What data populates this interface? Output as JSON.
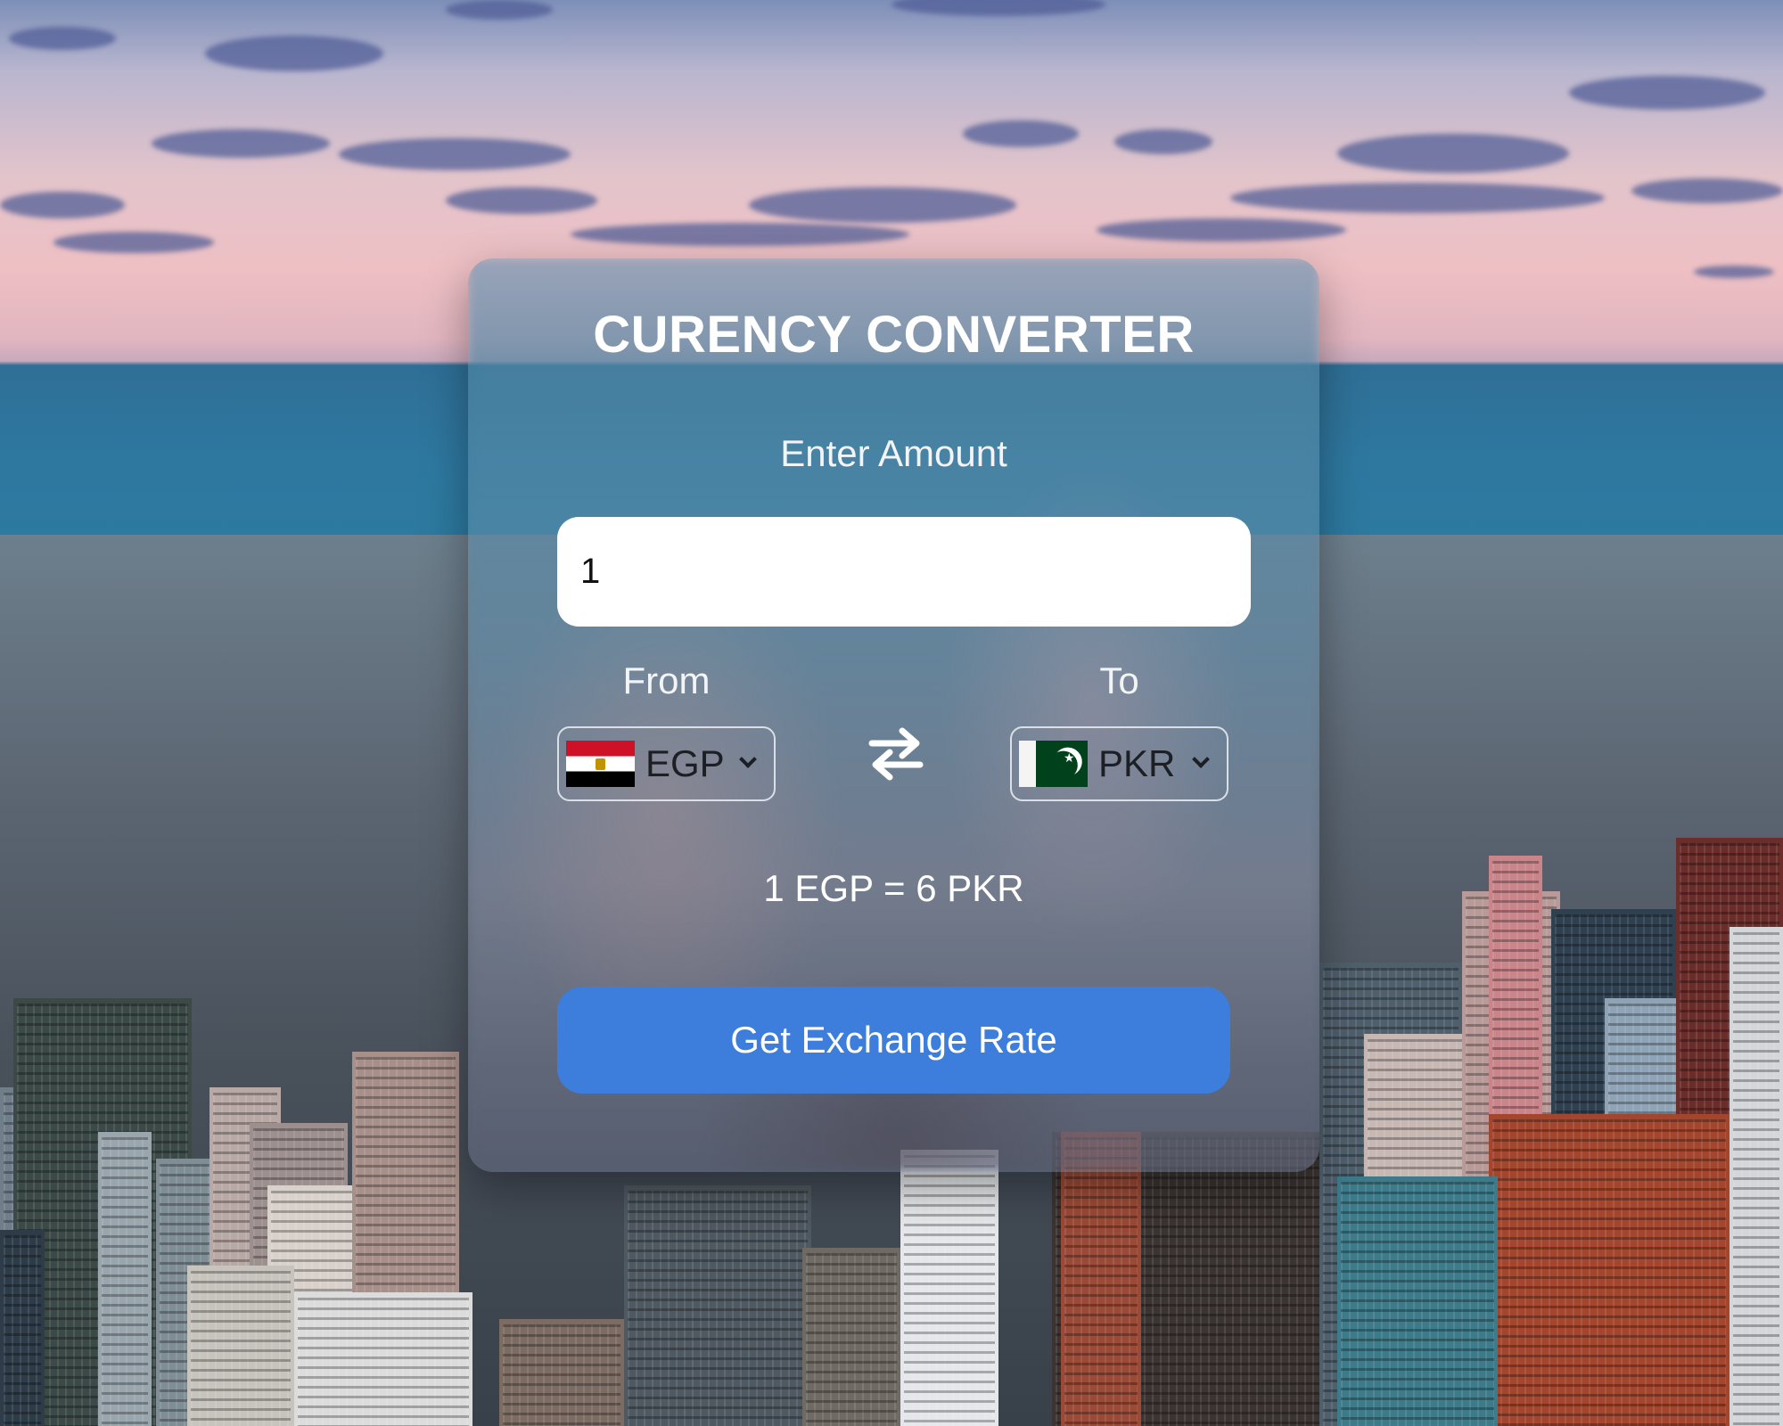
{
  "app": {
    "title": "CURENCY CONVERTER"
  },
  "amount": {
    "label": "Enter Amount",
    "value": "1"
  },
  "from": {
    "label": "From",
    "currency": "EGP",
    "flag_icon": "egypt-flag-icon"
  },
  "to": {
    "label": "To",
    "currency": "PKR",
    "flag_icon": "pakistan-flag-icon"
  },
  "swap": {
    "icon": "swap-arrows-icon"
  },
  "result": {
    "text": "1 EGP = 6 PKR"
  },
  "button": {
    "label": "Get Exchange Rate"
  },
  "colors": {
    "button": "#3d7ddb",
    "input_background": "#ffffff",
    "text": "#ffffff"
  }
}
